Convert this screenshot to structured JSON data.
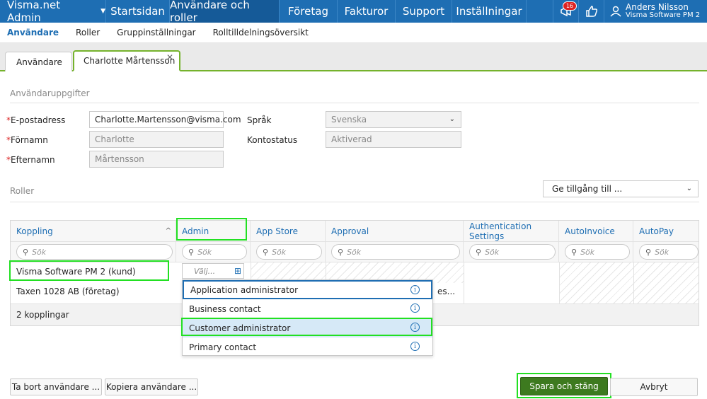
{
  "topnav": {
    "brand": "Visma.net Admin",
    "items": [
      {
        "label": "Startsidan"
      },
      {
        "label": "Användare och roller"
      },
      {
        "label": "Företag"
      },
      {
        "label": "Fakturor"
      },
      {
        "label": "Support"
      },
      {
        "label": "Inställningar"
      }
    ],
    "notification_count": "16",
    "user_name": "Anders Nilsson",
    "user_org": "Visma Software PM 2"
  },
  "subnav": {
    "items": [
      {
        "label": "Användare"
      },
      {
        "label": "Roller"
      },
      {
        "label": "Gruppinställningar"
      },
      {
        "label": "Rolltilldelningsöversikt"
      }
    ]
  },
  "tabs": [
    {
      "label": "Användare"
    },
    {
      "label": "Charlotte Mårtensson"
    }
  ],
  "user_details": {
    "section_title": "Användaruppgifter",
    "email_label": "E-postadress",
    "email_value": "Charlotte.Martensson@visma.com",
    "firstname_label": "Förnamn",
    "firstname_value": "Charlotte",
    "lastname_label": "Efternamn",
    "lastname_value": "Mårtensson",
    "language_label": "Språk",
    "language_value": "Svenska",
    "status_label": "Kontostatus",
    "status_value": "Aktiverad",
    "required_mark": "*"
  },
  "roles": {
    "section_title": "Roller",
    "access_dropdown": "Ge tillgång till ...",
    "columns": [
      {
        "label": "Koppling"
      },
      {
        "label": "Admin"
      },
      {
        "label": "App Store"
      },
      {
        "label": "Approval"
      },
      {
        "label": "Authentication Settings"
      },
      {
        "label": "AutoInvoice"
      },
      {
        "label": "AutoPay"
      }
    ],
    "search_placeholder": "Sök",
    "rows": [
      {
        "name": "Visma Software PM 2 (kund)"
      },
      {
        "name": "Taxen 1028 AB (företag)"
      }
    ],
    "row2_truncated": "es...",
    "footer": "2 kopplingar",
    "combo_placeholder": "Välj...",
    "options": [
      {
        "label": "Application administrator"
      },
      {
        "label": "Business contact"
      },
      {
        "label": "Customer administrator"
      },
      {
        "label": "Primary contact"
      }
    ]
  },
  "buttons": {
    "delete": "Ta bort användare ...",
    "copy": "Kopiera användare ...",
    "save": "Spara och stäng",
    "cancel": "Avbryt"
  },
  "colors": {
    "primary": "#1e6eb3",
    "accent_green": "#75b22c",
    "save_green": "#3d7a1f",
    "highlight": "#22e022"
  }
}
